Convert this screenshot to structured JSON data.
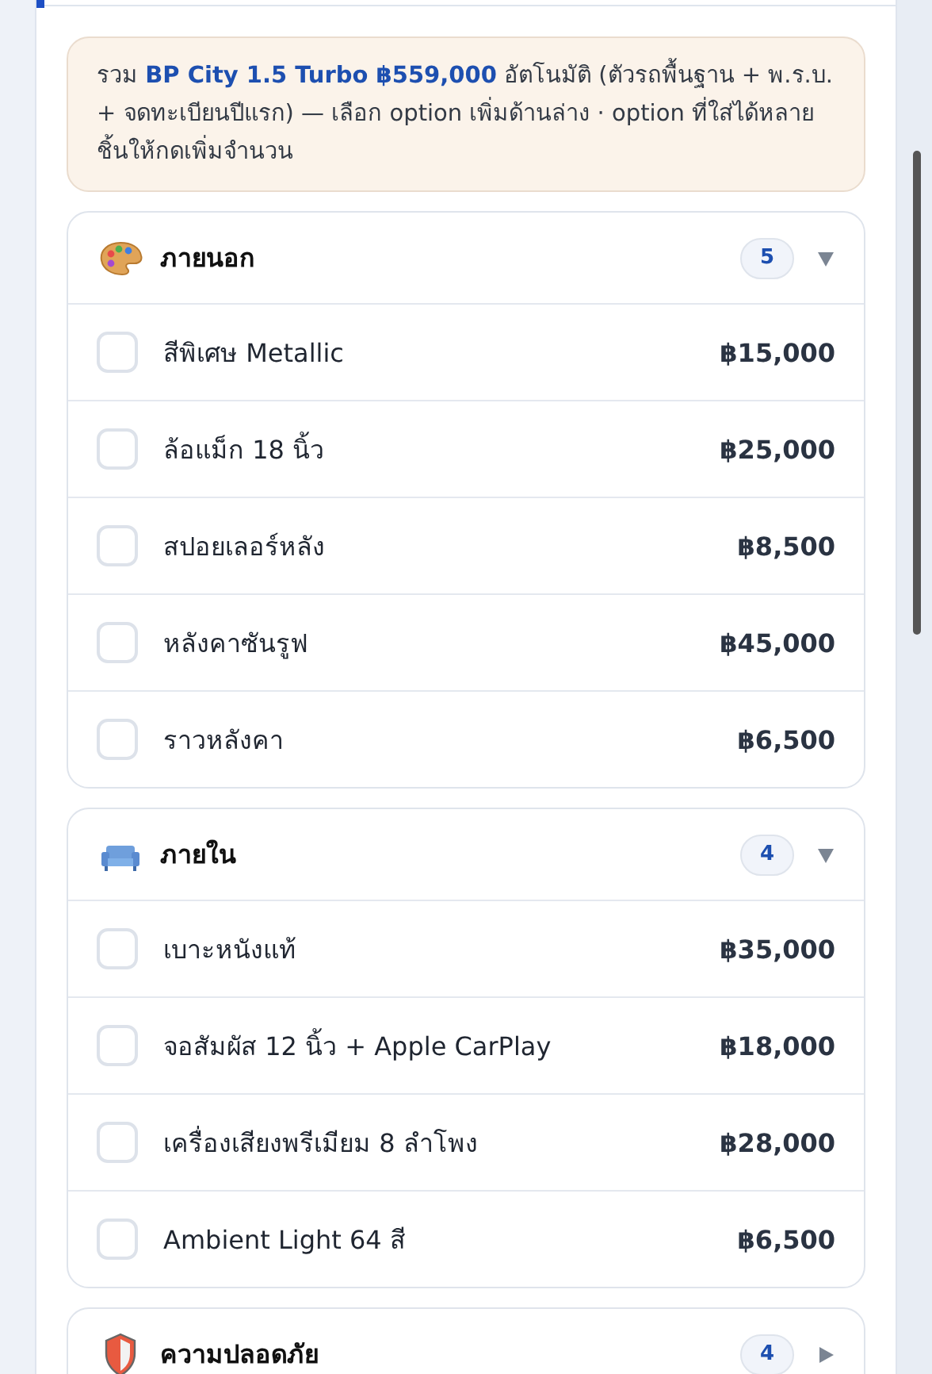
{
  "notice": "รวม **BP City 1.5 Turbo ฿559,000** อัตโนมัติ (ตัวรถพื้นฐาน + พ.ร.บ. + จดทะเบียนปีแรก) — เลือก option เพิ่มด้านล่าง · option ที่ใส่ได้หลายชิ้นให้กดเพิ่มจำนวน",
  "sections": [
    {
      "kind": "palette",
      "title": "ภายนอก",
      "count": "5",
      "expanded": true,
      "items": [
        {
          "name": "สีพิเศษ Metallic",
          "price": "฿15,000",
          "checked": false
        },
        {
          "name": "ล้อแม็ก 18 นิ้ว",
          "price": "฿25,000",
          "checked": false
        },
        {
          "name": "สปอยเลอร์หลัง",
          "price": "฿8,500",
          "checked": false
        },
        {
          "name": "หลังคาซันรูฟ",
          "price": "฿45,000",
          "checked": false
        },
        {
          "name": "ราวหลังคา",
          "price": "฿6,500",
          "checked": false
        }
      ]
    },
    {
      "kind": "sofa",
      "title": "ภายใน",
      "count": "4",
      "expanded": true,
      "items": [
        {
          "name": "เบาะหนังแท้",
          "price": "฿35,000",
          "checked": false
        },
        {
          "name": "จอสัมผัส 12 นิ้ว + Apple CarPlay",
          "price": "฿18,000",
          "checked": false
        },
        {
          "name": "เครื่องเสียงพรีเมียม 8 ลำโพง",
          "price": "฿28,000",
          "checked": false
        },
        {
          "name": "Ambient Light 64 สี",
          "price": "฿6,500",
          "checked": false
        }
      ]
    },
    {
      "kind": "shield",
      "title": "ความปลอดภัย",
      "count": "4",
      "expanded": false
    }
  ]
}
